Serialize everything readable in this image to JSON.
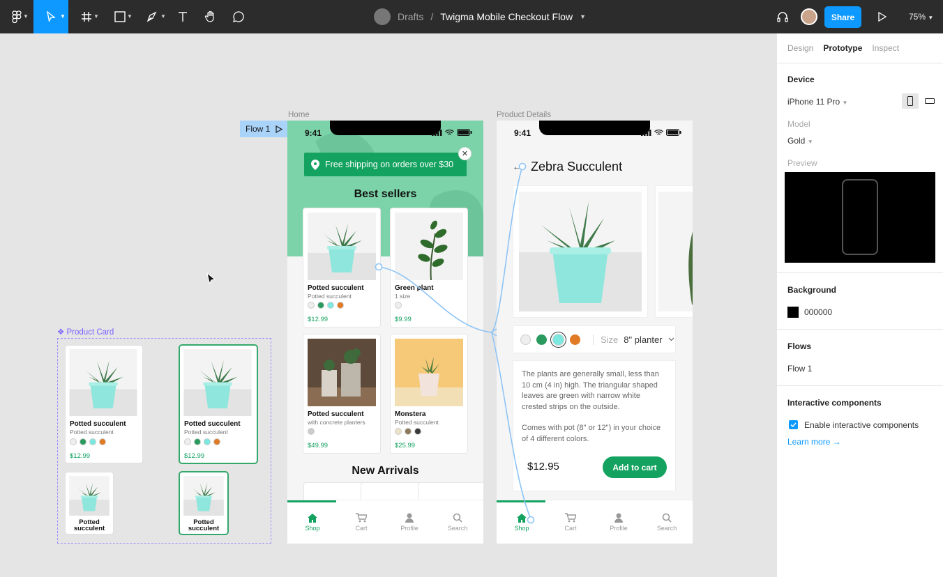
{
  "toolbar": {
    "tools": [
      {
        "name": "figma-menu",
        "icon": "figma-logo-icon"
      },
      {
        "name": "move",
        "icon": "cursor-arrow-icon",
        "active": true
      },
      {
        "name": "frame",
        "icon": "frame-hash-icon"
      },
      {
        "name": "shape",
        "icon": "square-icon"
      },
      {
        "name": "pen",
        "icon": "pen-icon"
      },
      {
        "name": "text",
        "icon": "text-t-icon"
      },
      {
        "name": "hand",
        "icon": "hand-icon"
      },
      {
        "name": "comment",
        "icon": "speech-bubble-icon"
      }
    ],
    "breadcrumb_parent": "Drafts",
    "breadcrumb_sep": "/",
    "file_name": "Twigma Mobile Checkout Flow",
    "share_label": "Share",
    "zoom": "75%",
    "accent": "#0d99ff"
  },
  "canvas": {
    "flow_tag": "Flow 1",
    "home_label": "Home",
    "details_label": "Product Details",
    "component_label": "Product Card"
  },
  "home": {
    "time": "9:41",
    "banner": "Free shipping on orders over $30",
    "close": "✕",
    "best_sellers": "Best sellers",
    "new_arrivals": "New Arrivals",
    "cards": [
      {
        "name": "Potted succulent",
        "sub": "Potted succulent",
        "price": "$12.99",
        "swatches": [
          "#eeeeee",
          "#2b9a5f",
          "#7ce8e0",
          "#e07a24"
        ]
      },
      {
        "name": "Green plant",
        "sub": "1 size",
        "price": "$9.99",
        "swatches": [
          "#eeeeee"
        ]
      },
      {
        "name": "Potted succulent",
        "sub": "with concrete planters",
        "price": "$49.99",
        "swatches": [
          "#cccccc"
        ]
      },
      {
        "name": "Monstera",
        "sub": "Potted succulent",
        "price": "$25.99",
        "swatches": [
          "#e9e2c8",
          "#8a7a5a",
          "#3a3a3a"
        ]
      }
    ],
    "tabs": [
      "Shop",
      "Cart",
      "Profile",
      "Search"
    ],
    "brand": "#13a25f"
  },
  "details": {
    "time": "9:41",
    "back": "←",
    "title": "Zebra Succulent",
    "swatches": [
      "#eeeeee",
      "#2b9a5f",
      "#7ce8e0",
      "#e07a24"
    ],
    "size_label": "Size",
    "size_value": "8\" planter",
    "desc1": "The plants are generally small, less than 10 cm (4 in) high. The triangular shaped leaves are green with narrow white crested strips on the outside.",
    "desc2": "Comes with pot (8\" or 12\") in your choice of 4 different colors.",
    "price": "$12.95",
    "add_to_cart": "Add to cart",
    "tabs": [
      "Shop",
      "Cart",
      "Profile",
      "Search"
    ]
  },
  "component": {
    "large_name": "Potted succulent",
    "large_sub": "Potted succulent",
    "large_price": "$12.99",
    "small_name": "Potted succulent"
  },
  "panel": {
    "tabs": [
      "Design",
      "Prototype",
      "Inspect"
    ],
    "active_tab": "Prototype",
    "device_heading": "Device",
    "device_value": "iPhone 11 Pro",
    "model_label": "Model",
    "model_value": "Gold",
    "preview_label": "Preview",
    "background_heading": "Background",
    "background_value": "000000",
    "flows_heading": "Flows",
    "flow_item": "Flow 1",
    "interactive_heading": "Interactive components",
    "interactive_checkbox": "Enable interactive components",
    "learn_more": "Learn more →"
  }
}
